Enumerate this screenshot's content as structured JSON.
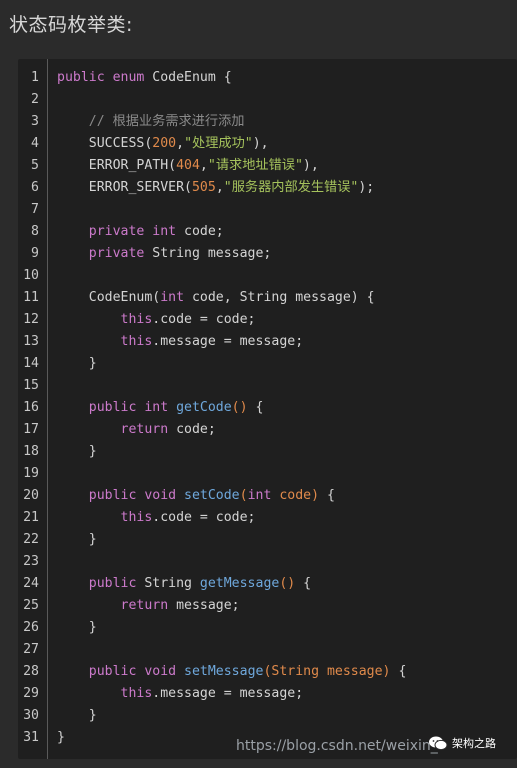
{
  "heading": "状态码枚举类:",
  "code_lines": [
    [
      {
        "t": "public enum ",
        "c": "kw"
      },
      {
        "t": "CodeEnum {",
        "c": ""
      }
    ],
    [],
    [
      {
        "t": "    // 根据业务需求进行添加",
        "c": "cm"
      }
    ],
    [
      {
        "t": "    SUCCESS(",
        "c": ""
      },
      {
        "t": "200",
        "c": "num"
      },
      {
        "t": ",",
        "c": ""
      },
      {
        "t": "\"处理成功\"",
        "c": "str"
      },
      {
        "t": "),",
        "c": ""
      }
    ],
    [
      {
        "t": "    ERROR_PATH(",
        "c": ""
      },
      {
        "t": "404",
        "c": "num"
      },
      {
        "t": ",",
        "c": ""
      },
      {
        "t": "\"请求地址错误\"",
        "c": "str"
      },
      {
        "t": "),",
        "c": ""
      }
    ],
    [
      {
        "t": "    ERROR_SERVER(",
        "c": ""
      },
      {
        "t": "505",
        "c": "num"
      },
      {
        "t": ",",
        "c": ""
      },
      {
        "t": "\"服务器内部发生错误\"",
        "c": "str"
      },
      {
        "t": ");",
        "c": ""
      }
    ],
    [],
    [
      {
        "t": "    private int ",
        "c": "kw"
      },
      {
        "t": "code;",
        "c": ""
      }
    ],
    [
      {
        "t": "    private ",
        "c": "kw"
      },
      {
        "t": "String message;",
        "c": ""
      }
    ],
    [],
    [
      {
        "t": "    CodeEnum(",
        "c": ""
      },
      {
        "t": "int ",
        "c": "kw"
      },
      {
        "t": "code, String message) {",
        "c": ""
      }
    ],
    [
      {
        "t": "        this",
        "c": "kw"
      },
      {
        "t": ".code = code;",
        "c": ""
      }
    ],
    [
      {
        "t": "        this",
        "c": "kw"
      },
      {
        "t": ".message = message;",
        "c": ""
      }
    ],
    [
      {
        "t": "    }",
        "c": ""
      }
    ],
    [],
    [
      {
        "t": "    public int ",
        "c": "kw"
      },
      {
        "t": "getCode",
        "c": "fn"
      },
      {
        "t": "()",
        "c": "param"
      },
      {
        "t": " {",
        "c": ""
      }
    ],
    [
      {
        "t": "        return ",
        "c": "kw"
      },
      {
        "t": "code;",
        "c": ""
      }
    ],
    [
      {
        "t": "    }",
        "c": ""
      }
    ],
    [],
    [
      {
        "t": "    public void ",
        "c": "kw"
      },
      {
        "t": "setCode",
        "c": "fn"
      },
      {
        "t": "(",
        "c": "param"
      },
      {
        "t": "int ",
        "c": "kw"
      },
      {
        "t": "code)",
        "c": "param"
      },
      {
        "t": " {",
        "c": ""
      }
    ],
    [
      {
        "t": "        this",
        "c": "kw"
      },
      {
        "t": ".code = code;",
        "c": ""
      }
    ],
    [
      {
        "t": "    }",
        "c": ""
      }
    ],
    [],
    [
      {
        "t": "    public ",
        "c": "kw"
      },
      {
        "t": "String ",
        "c": ""
      },
      {
        "t": "getMessage",
        "c": "fn"
      },
      {
        "t": "()",
        "c": "param"
      },
      {
        "t": " {",
        "c": ""
      }
    ],
    [
      {
        "t": "        return ",
        "c": "kw"
      },
      {
        "t": "message;",
        "c": ""
      }
    ],
    [
      {
        "t": "    }",
        "c": ""
      }
    ],
    [],
    [
      {
        "t": "    public void ",
        "c": "kw"
      },
      {
        "t": "setMessage",
        "c": "fn"
      },
      {
        "t": "(String message)",
        "c": "param"
      },
      {
        "t": " {",
        "c": ""
      }
    ],
    [
      {
        "t": "        this",
        "c": "kw"
      },
      {
        "t": ".message = message;",
        "c": ""
      }
    ],
    [
      {
        "t": "    }",
        "c": ""
      }
    ],
    [
      {
        "t": "}",
        "c": ""
      }
    ]
  ],
  "watermark": "https://blog.csdn.net/weixin_",
  "badge": {
    "icon": "wechat-icon",
    "label": "架构之路"
  },
  "colors": {
    "background": "#2b2b2b",
    "code_background": "#1f1f1f",
    "keyword": "#cc7acb",
    "comment": "#8a8a8a",
    "number": "#e08a4b",
    "string": "#a5c25c",
    "function": "#6fa8dc"
  }
}
